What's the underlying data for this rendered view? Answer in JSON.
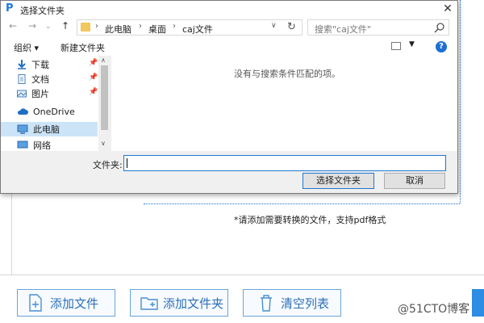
{
  "dialog": {
    "title": "选择文件夹",
    "close": "✕",
    "nav": {
      "back": "←",
      "forward": "→",
      "up": "↑"
    },
    "breadcrumb": [
      "此电脑",
      "桌面",
      "caj文件"
    ],
    "search_placeholder": "搜索\"caj文件\"",
    "toolbar": {
      "organize": "组织 ▾",
      "new_folder": "新建文件夹",
      "help": "?"
    },
    "sidebar": [
      {
        "label": "下载",
        "icon": "download-icon",
        "pinned": true
      },
      {
        "label": "文档",
        "icon": "document-icon",
        "pinned": true
      },
      {
        "label": "图片",
        "icon": "picture-icon",
        "pinned": true
      },
      {
        "label": "OneDrive",
        "icon": "cloud-icon",
        "pinned": false
      },
      {
        "label": "此电脑",
        "icon": "computer-icon",
        "pinned": false,
        "selected": true
      },
      {
        "label": "网络",
        "icon": "network-icon",
        "pinned": false
      }
    ],
    "empty_message": "没有与搜索条件匹配的项。",
    "folder_label": "文件夹:",
    "folder_value": "",
    "select_button": "选择文件夹",
    "cancel_button": "取消"
  },
  "app": {
    "hint": "*请添加需要转换的文件，支持pdf格式",
    "buttons": [
      "添加文件",
      "添加文件夹",
      "清空列表"
    ],
    "watermark": "@51CTO博客"
  },
  "colors": {
    "accent": "#1e78d0",
    "selected": "#cce4f7",
    "app_button_text": "#2c6fb6"
  }
}
